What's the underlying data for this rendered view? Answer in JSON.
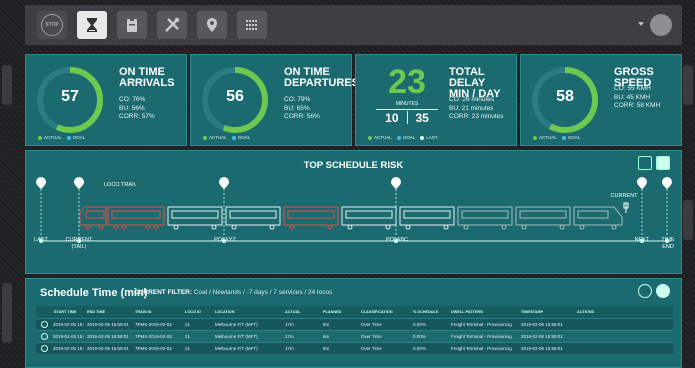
{
  "toolbar": {
    "stop_label": "STOP",
    "buttons": [
      "hourglass-icon",
      "clipboard-icon",
      "tools-icon",
      "map-pin-icon",
      "schedule-grid-icon"
    ]
  },
  "colors": {
    "panel": "#1a6a70",
    "gauge": "#6cc84e",
    "actual": "#6cc84e",
    "goal": "#4ab6ea",
    "risk": "#e04d46"
  },
  "kpis": [
    {
      "value": "57",
      "gauge_fraction": 0.57,
      "title_line1": "ON TIME",
      "title_line2": "ARRIVALS",
      "stat1": "CO: 76%",
      "stat2": "BU: 56%",
      "stat3": "CORR: 57%",
      "legend_actual": "ACTUAL",
      "legend_goal": "GOAL"
    },
    {
      "value": "56",
      "gauge_fraction": 0.56,
      "title_line1": "ON TIME",
      "title_line2": "DEPARTURES",
      "stat1": "CO: 79%",
      "stat2": "BU: 65%",
      "stat3": "CORR: 56%",
      "legend_actual": "ACTUAL",
      "legend_goal": "GOAL"
    },
    {
      "value": "23",
      "minutes_label": "MINUTES",
      "split_left": "10",
      "split_right": "35",
      "title_line1": "TOTAL DELAY",
      "title_line2": "MIN / DAY",
      "stat1": "CO: 26 minutes",
      "stat2": "BU: 21 minutes",
      "stat3": "CORR: 23 minutes",
      "legend_actual": "ACTUAL",
      "legend_goal": "GOAL",
      "legend_last": "LAST"
    },
    {
      "value": "58",
      "gauge_fraction": 0.58,
      "title_line1": "GROSS SPEED",
      "title_line2": "",
      "stat1": "CO: 55 KMH",
      "stat2": "BU: 45 KMH",
      "stat3": "CORR: 58 KMH",
      "legend_actual": "ACTUAL",
      "legend_goal": "GOAL"
    }
  ],
  "risk": {
    "title": "TOP SCHEDULE RISK",
    "loco_trail": "LOCO TRAIL",
    "markers": {
      "last": "LAST",
      "current_tail_1": "CURRENT",
      "current_tail_2": "(TAIL)",
      "poi_xyz": "POI XYZ",
      "poi_abc": "POI ABC",
      "current": "CURRENT",
      "next": "NEXT",
      "time_end_1": "TIME",
      "time_end_2": "END"
    }
  },
  "schedule": {
    "title": "Schedule Time (min)",
    "filter_label": "CURRENT FILTER:",
    "filter_value": "Coal / Newlands / -7 days / 7 services / 24 locos",
    "columns": [
      "START TIME",
      "END TIME",
      "TRAIN ID",
      "LOCO ID",
      "LOCATION",
      "ACTUAL",
      "PLANNED",
      "CLASSIFICATION",
      "% SCHEDULE",
      "DWELL PATTERN",
      "TIMESTAMP",
      "ACTIONS"
    ],
    "rows": [
      [
        "2019-02-05 15:02:39",
        "2019-02-05 15:59:01",
        "7PMS-2019-02-02",
        "21",
        "Melbourne F/T (MFT)",
        "17m",
        "6m",
        "Over Time",
        "0.00%",
        "Freight Terminal - Provisioning",
        "2019-02-05 15:59:01"
      ],
      [
        "2019-02-05 15:02:39",
        "2019-02-05 15:59:01",
        "7PMS-2019-02-02",
        "21",
        "Melbourne F/T (MFT)",
        "17m",
        "6m",
        "Over Time",
        "0.00%",
        "Freight Terminal - Provisioning",
        "2019-02-05 15:59:01"
      ],
      [
        "2019-02-05 15:02:39",
        "2019-02-05 15:59:01",
        "7PMS-2019-02-02",
        "21",
        "Melbourne F/T (MFT)",
        "17m",
        "6m",
        "Over Time",
        "0.00%",
        "Freight Terminal - Provisioning",
        "2019-02-05 15:59:01"
      ]
    ]
  }
}
